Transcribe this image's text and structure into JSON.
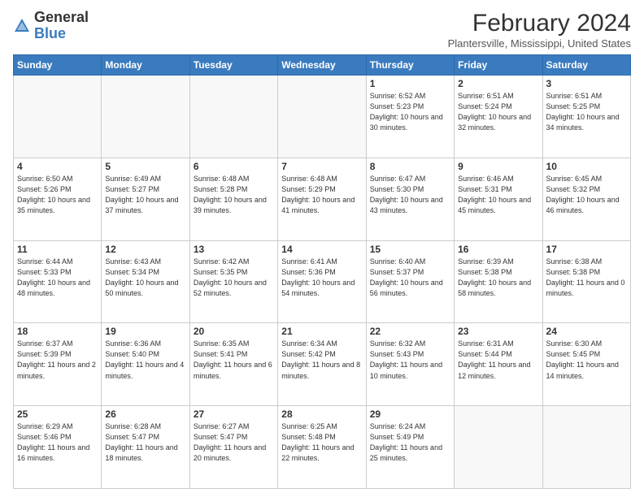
{
  "logo": {
    "general": "General",
    "blue": "Blue"
  },
  "title": "February 2024",
  "location": "Plantersville, Mississippi, United States",
  "headers": [
    "Sunday",
    "Monday",
    "Tuesday",
    "Wednesday",
    "Thursday",
    "Friday",
    "Saturday"
  ],
  "weeks": [
    [
      {
        "day": "",
        "info": ""
      },
      {
        "day": "",
        "info": ""
      },
      {
        "day": "",
        "info": ""
      },
      {
        "day": "",
        "info": ""
      },
      {
        "day": "1",
        "info": "Sunrise: 6:52 AM\nSunset: 5:23 PM\nDaylight: 10 hours\nand 30 minutes."
      },
      {
        "day": "2",
        "info": "Sunrise: 6:51 AM\nSunset: 5:24 PM\nDaylight: 10 hours\nand 32 minutes."
      },
      {
        "day": "3",
        "info": "Sunrise: 6:51 AM\nSunset: 5:25 PM\nDaylight: 10 hours\nand 34 minutes."
      }
    ],
    [
      {
        "day": "4",
        "info": "Sunrise: 6:50 AM\nSunset: 5:26 PM\nDaylight: 10 hours\nand 35 minutes."
      },
      {
        "day": "5",
        "info": "Sunrise: 6:49 AM\nSunset: 5:27 PM\nDaylight: 10 hours\nand 37 minutes."
      },
      {
        "day": "6",
        "info": "Sunrise: 6:48 AM\nSunset: 5:28 PM\nDaylight: 10 hours\nand 39 minutes."
      },
      {
        "day": "7",
        "info": "Sunrise: 6:48 AM\nSunset: 5:29 PM\nDaylight: 10 hours\nand 41 minutes."
      },
      {
        "day": "8",
        "info": "Sunrise: 6:47 AM\nSunset: 5:30 PM\nDaylight: 10 hours\nand 43 minutes."
      },
      {
        "day": "9",
        "info": "Sunrise: 6:46 AM\nSunset: 5:31 PM\nDaylight: 10 hours\nand 45 minutes."
      },
      {
        "day": "10",
        "info": "Sunrise: 6:45 AM\nSunset: 5:32 PM\nDaylight: 10 hours\nand 46 minutes."
      }
    ],
    [
      {
        "day": "11",
        "info": "Sunrise: 6:44 AM\nSunset: 5:33 PM\nDaylight: 10 hours\nand 48 minutes."
      },
      {
        "day": "12",
        "info": "Sunrise: 6:43 AM\nSunset: 5:34 PM\nDaylight: 10 hours\nand 50 minutes."
      },
      {
        "day": "13",
        "info": "Sunrise: 6:42 AM\nSunset: 5:35 PM\nDaylight: 10 hours\nand 52 minutes."
      },
      {
        "day": "14",
        "info": "Sunrise: 6:41 AM\nSunset: 5:36 PM\nDaylight: 10 hours\nand 54 minutes."
      },
      {
        "day": "15",
        "info": "Sunrise: 6:40 AM\nSunset: 5:37 PM\nDaylight: 10 hours\nand 56 minutes."
      },
      {
        "day": "16",
        "info": "Sunrise: 6:39 AM\nSunset: 5:38 PM\nDaylight: 10 hours\nand 58 minutes."
      },
      {
        "day": "17",
        "info": "Sunrise: 6:38 AM\nSunset: 5:38 PM\nDaylight: 11 hours\nand 0 minutes."
      }
    ],
    [
      {
        "day": "18",
        "info": "Sunrise: 6:37 AM\nSunset: 5:39 PM\nDaylight: 11 hours\nand 2 minutes."
      },
      {
        "day": "19",
        "info": "Sunrise: 6:36 AM\nSunset: 5:40 PM\nDaylight: 11 hours\nand 4 minutes."
      },
      {
        "day": "20",
        "info": "Sunrise: 6:35 AM\nSunset: 5:41 PM\nDaylight: 11 hours\nand 6 minutes."
      },
      {
        "day": "21",
        "info": "Sunrise: 6:34 AM\nSunset: 5:42 PM\nDaylight: 11 hours\nand 8 minutes."
      },
      {
        "day": "22",
        "info": "Sunrise: 6:32 AM\nSunset: 5:43 PM\nDaylight: 11 hours\nand 10 minutes."
      },
      {
        "day": "23",
        "info": "Sunrise: 6:31 AM\nSunset: 5:44 PM\nDaylight: 11 hours\nand 12 minutes."
      },
      {
        "day": "24",
        "info": "Sunrise: 6:30 AM\nSunset: 5:45 PM\nDaylight: 11 hours\nand 14 minutes."
      }
    ],
    [
      {
        "day": "25",
        "info": "Sunrise: 6:29 AM\nSunset: 5:46 PM\nDaylight: 11 hours\nand 16 minutes."
      },
      {
        "day": "26",
        "info": "Sunrise: 6:28 AM\nSunset: 5:47 PM\nDaylight: 11 hours\nand 18 minutes."
      },
      {
        "day": "27",
        "info": "Sunrise: 6:27 AM\nSunset: 5:47 PM\nDaylight: 11 hours\nand 20 minutes."
      },
      {
        "day": "28",
        "info": "Sunrise: 6:25 AM\nSunset: 5:48 PM\nDaylight: 11 hours\nand 22 minutes."
      },
      {
        "day": "29",
        "info": "Sunrise: 6:24 AM\nSunset: 5:49 PM\nDaylight: 11 hours\nand 25 minutes."
      },
      {
        "day": "",
        "info": ""
      },
      {
        "day": "",
        "info": ""
      }
    ]
  ]
}
